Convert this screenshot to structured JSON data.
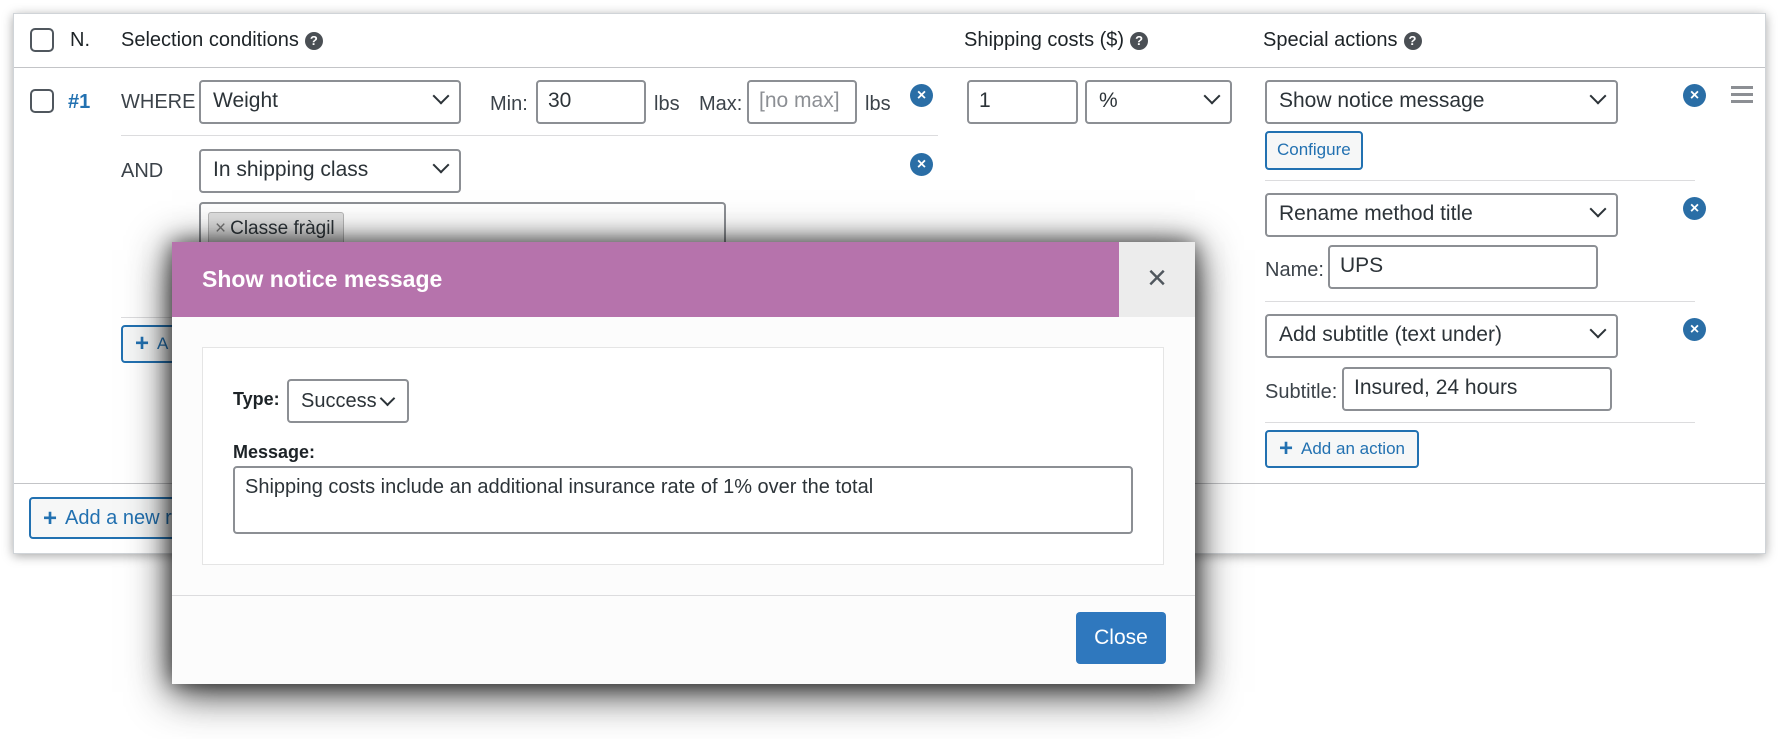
{
  "table": {
    "headers": {
      "num": "N.",
      "conditions": "Selection conditions",
      "costs": "Shipping costs ($)",
      "actions": "Special actions"
    },
    "rule": {
      "number": "#1",
      "where_label": "WHERE",
      "and_label": "AND",
      "condition1": {
        "field": "Weight",
        "min_label": "Min:",
        "min_value": "30",
        "unit": "lbs",
        "max_label": "Max:",
        "max_placeholder": "[no max]",
        "unit2": "lbs"
      },
      "condition2": {
        "field": "In shipping class",
        "tag": "Classe fràgil",
        "tag_remove": "×"
      },
      "add_condition_partial": "A",
      "cost_value": "1",
      "cost_type": "%",
      "actions": [
        {
          "select": "Show notice message",
          "button": "Configure"
        },
        {
          "select": "Rename method title",
          "field_label": "Name:",
          "field_value": "UPS"
        },
        {
          "select": "Add subtitle (text under)",
          "field_label": "Subtitle:",
          "field_value": "Insured, 24 hours"
        }
      ],
      "add_action": "Add an action"
    },
    "add_rule_partial": "Add a new r"
  },
  "modal": {
    "title": "Show notice message",
    "close_glyph": "×",
    "type_label": "Type:",
    "type_value": "Success",
    "message_label": "Message:",
    "message_value": "Shipping costs include an additional insurance rate of 1% over the total",
    "close_button": "Close"
  },
  "icons": {
    "remove": "×",
    "help": "?",
    "plus": "+"
  },
  "colors": {
    "modal_header": "#b673ac",
    "primary": "#2271b1",
    "remove_icon": "#2a6ea6"
  }
}
